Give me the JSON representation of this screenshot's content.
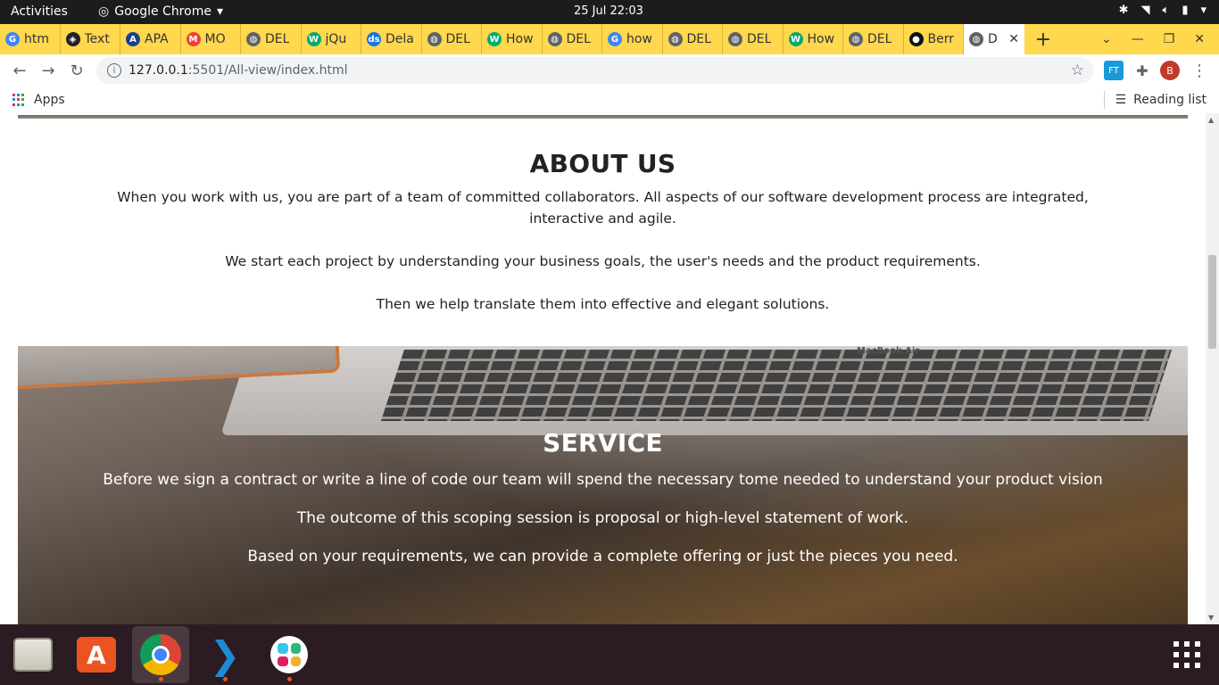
{
  "system": {
    "activities": "Activities",
    "app_name": "Google Chrome",
    "clock": "25 Jul  22:03"
  },
  "tabs": [
    {
      "label": "htm",
      "icon": "google-icon",
      "color": "#4285f4",
      "glyph": "G"
    },
    {
      "label": "Text",
      "icon": "codepen-icon",
      "color": "#222222",
      "glyph": "◈"
    },
    {
      "label": "APA",
      "icon": "apa-icon",
      "color": "#1a3f8f",
      "glyph": "A"
    },
    {
      "label": "MO",
      "icon": "gmail-icon",
      "color": "#ea4335",
      "glyph": "M"
    },
    {
      "label": "DEL",
      "icon": "globe-icon",
      "color": "#5f6368",
      "glyph": "◍"
    },
    {
      "label": "jQu",
      "icon": "w3schools-icon",
      "color": "#04aa6d",
      "glyph": "W"
    },
    {
      "label": "Dela",
      "icon": "dailysmarty-icon",
      "color": "#1a73e8",
      "glyph": "ds"
    },
    {
      "label": "DEL",
      "icon": "globe-icon",
      "color": "#5f6368",
      "glyph": "◍"
    },
    {
      "label": "How",
      "icon": "w3schools-icon",
      "color": "#04aa6d",
      "glyph": "W"
    },
    {
      "label": "DEL",
      "icon": "globe-icon",
      "color": "#5f6368",
      "glyph": "◍"
    },
    {
      "label": "how",
      "icon": "google-icon",
      "color": "#4285f4",
      "glyph": "G"
    },
    {
      "label": "DEL",
      "icon": "globe-icon",
      "color": "#5f6368",
      "glyph": "◍"
    },
    {
      "label": "DEL",
      "icon": "globe-icon",
      "color": "#5f6368",
      "glyph": "◍"
    },
    {
      "label": "How",
      "icon": "w3schools-icon",
      "color": "#04aa6d",
      "glyph": "W"
    },
    {
      "label": "DEL",
      "icon": "globe-icon",
      "color": "#5f6368",
      "glyph": "◍"
    },
    {
      "label": "Berr",
      "icon": "github-icon",
      "color": "#111111",
      "glyph": "●"
    }
  ],
  "active_tab": {
    "label": "D",
    "icon": "globe-icon",
    "close": "✕"
  },
  "toolbar": {
    "url_host": "127.0.0.1",
    "url_rest": ":5501/All-view/index.html",
    "profile_initial": "B",
    "ext_label": "FT"
  },
  "bookmarks": {
    "apps": "Apps",
    "reading_list": "Reading list"
  },
  "about": {
    "title": "ABOUT US",
    "p1": "When you work with us, you are part of a team of committed collaborators. All aspects of our software development process are integrated, interactive and agile.",
    "p2": "We start each project by understanding your business goals, the user's needs and the product requirements.",
    "p3": "Then we help translate them into effective and elegant solutions."
  },
  "service": {
    "title": "SERVICE",
    "p1": "Before we sign a contract or write a line of code our team will spend the necessary tome needed to understand your product vision",
    "p2": "The outcome of this scoping session is proposal or high-level statement of work.",
    "p3": "Based on your requirements, we can provide a complete offering or just the pieces you need.",
    "image_brand": "MacBook Air"
  },
  "dock": {
    "items": [
      "files-icon",
      "software-store-icon",
      "chrome-icon",
      "vscode-icon",
      "slack-icon"
    ]
  },
  "colors": {
    "tab_strip": "#ffd84d",
    "dock": "#2b1b22",
    "topbar": "#1c1c1c"
  }
}
